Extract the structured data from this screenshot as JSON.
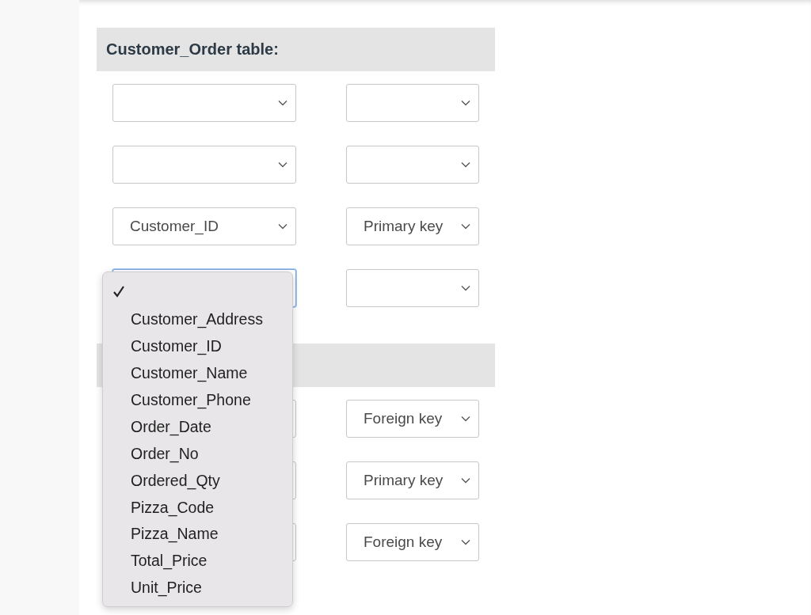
{
  "sections": [
    {
      "title": "Customer_Order table:",
      "rows": [
        {
          "field": {
            "focused": false,
            "open": false
          },
          "key": {}
        },
        {
          "field": {
            "focused": false,
            "open": false
          },
          "key": {}
        },
        {
          "field": {
            "value": "Customer_ID",
            "focused": false,
            "open": false
          },
          "key": {
            "value": "Primary key"
          }
        },
        {
          "field": {
            "focused": true,
            "open": true
          },
          "key": {}
        }
      ]
    },
    {
      "rows": [
        {
          "field": {
            "focused": false,
            "open": false
          },
          "key": {
            "value": "Foreign key"
          }
        },
        {
          "field": {
            "focused": false,
            "open": false
          },
          "key": {
            "value": "Primary key"
          }
        },
        {
          "field": {
            "focused": false,
            "open": false
          },
          "key": {
            "value": "Foreign key"
          }
        }
      ]
    }
  ],
  "dropdown": {
    "options": [
      {
        "selected": true
      },
      {
        "label": "Customer_Address",
        "selected": false
      },
      {
        "label": "Customer_ID",
        "selected": false
      },
      {
        "label": "Customer_Name",
        "selected": false
      },
      {
        "label": "Customer_Phone",
        "selected": false
      },
      {
        "label": "Order_Date",
        "selected": false
      },
      {
        "label": "Order_No",
        "selected": false
      },
      {
        "label": "Ordered_Qty",
        "selected": false
      },
      {
        "label": "Pizza_Code",
        "selected": false
      },
      {
        "label": "Pizza_Name",
        "selected": false
      },
      {
        "label": "Total_Price",
        "selected": false
      },
      {
        "label": "Unit_Price",
        "selected": false
      }
    ]
  }
}
